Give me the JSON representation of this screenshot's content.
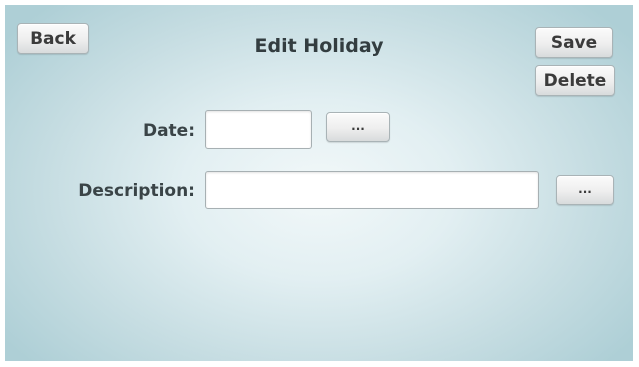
{
  "header": {
    "title": "Edit Holiday",
    "back_label": "Back",
    "save_label": "Save",
    "delete_label": "Delete"
  },
  "form": {
    "date": {
      "label": "Date:",
      "value": "",
      "picker_label": "..."
    },
    "description": {
      "label": "Description:",
      "value": "",
      "picker_label": "..."
    }
  },
  "colors": {
    "background_center": "#f2f8f9",
    "background_edge": "#aecfd6",
    "text": "#333d40"
  }
}
